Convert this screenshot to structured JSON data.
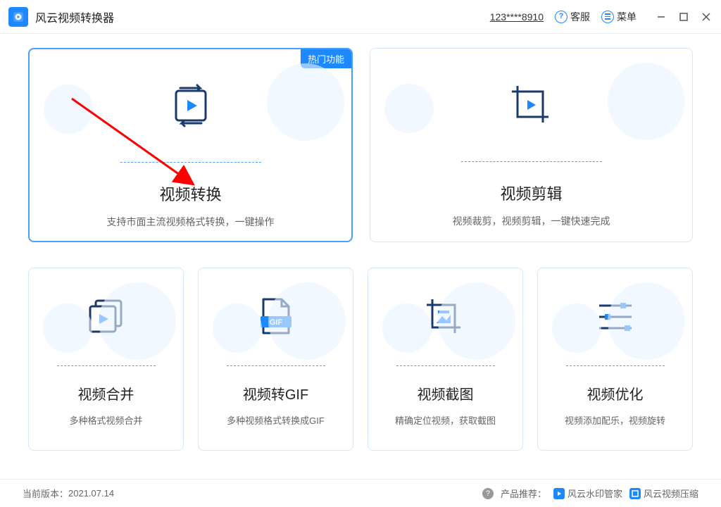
{
  "app": {
    "title": "风云视频转换器"
  },
  "titlebar": {
    "account": "123****8910",
    "support": "客服",
    "menu": "菜单"
  },
  "cards_large": [
    {
      "title": "视频转换",
      "desc": "支持市面主流视频格式转换，一键操作",
      "badge": "热门功能"
    },
    {
      "title": "视频剪辑",
      "desc": "视频裁剪，视频剪辑，一键快速完成"
    }
  ],
  "cards_small": [
    {
      "title": "视频合并",
      "desc": "多种格式视频合并"
    },
    {
      "title": "视频转GIF",
      "desc": "多种视频格式转换成GIF"
    },
    {
      "title": "视频截图",
      "desc": "精确定位视频，获取截图"
    },
    {
      "title": "视频优化",
      "desc": "视频添加配乐，视频旋转"
    }
  ],
  "gif_label": "GIF",
  "footer": {
    "version_label": "当前版本：",
    "version": "2021.07.14",
    "recommend_label": "产品推荐：",
    "rec1": "风云水印管家",
    "rec2": "风云视频压缩"
  }
}
